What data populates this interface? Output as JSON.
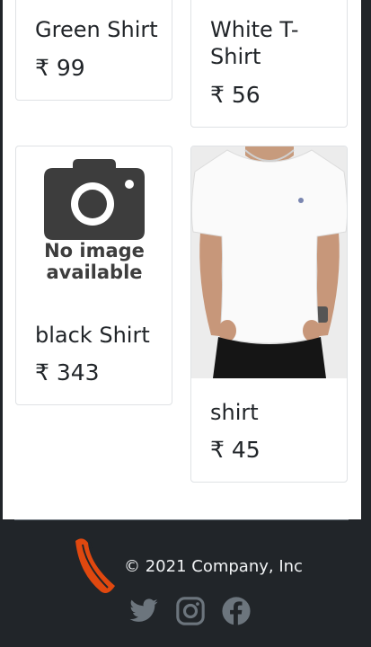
{
  "products": [
    {
      "title": "Green Shirt",
      "price": "₹ 99"
    },
    {
      "title": "White T-",
      "title_line2": "Shirt",
      "price": "₹ 56"
    },
    {
      "title": "black Shirt",
      "price": "₹ 343",
      "image": "No image available",
      "image_line1": "No image",
      "image_line2": "available"
    },
    {
      "title": "shirt",
      "price": "₹ 45"
    }
  ],
  "footer": {
    "copyright": "© 2021 Company, Inc",
    "social_icons": [
      "twitter-icon",
      "instagram-icon",
      "facebook-icon"
    ]
  },
  "colors": {
    "footer_bg": "#212529",
    "logo_orange": "#e0480f",
    "icon_gray": "#6c757d"
  }
}
